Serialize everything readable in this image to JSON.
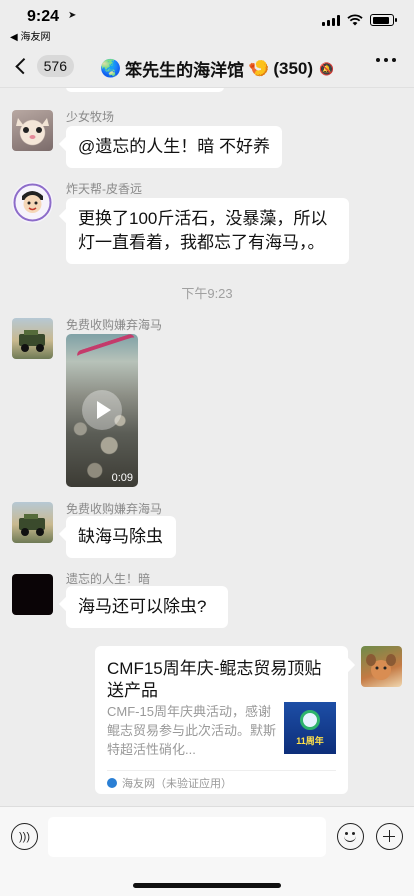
{
  "status_bar": {
    "time": "9:24",
    "back_app": "◀ 海友网",
    "battery_level": 0.85
  },
  "nav": {
    "unread_count": "576",
    "title": "笨先生的海洋馆",
    "member_count": "(350)",
    "icons": [
      "back-chevron-icon",
      "globe-icon",
      "fish-emoji-icon",
      "mute-icon",
      "more-icon"
    ]
  },
  "messages": [
    {
      "sender": "少女牧场",
      "text": "@遗忘的人生！暗 不好养"
    },
    {
      "sender": "炸天帮-皮香远",
      "text_line1": "更换了100斤活石，没暴藻，所以",
      "text_line2": "灯一直看着，我都忘了有海马，。"
    },
    {
      "timestamp": "下午9:23"
    },
    {
      "sender": "免费收购嫌弃海马",
      "video_duration": "0:09"
    },
    {
      "sender": "免费收购嫌弃海马",
      "text": "缺海马除虫"
    },
    {
      "sender": "遗忘的人生！暗",
      "text": "海马还可以除虫?"
    },
    {
      "card": {
        "title": "CMF15周年庆-鲲志贸易顶贴送产品",
        "description": "CMF-15周年庆典活动，感谢鲲志贸易参与此次活动。默斯特超活性硝化...",
        "thumb_text": "11周年",
        "source": "海友网（未验证应用）"
      }
    }
  ],
  "input_bar": {
    "placeholder": ""
  }
}
